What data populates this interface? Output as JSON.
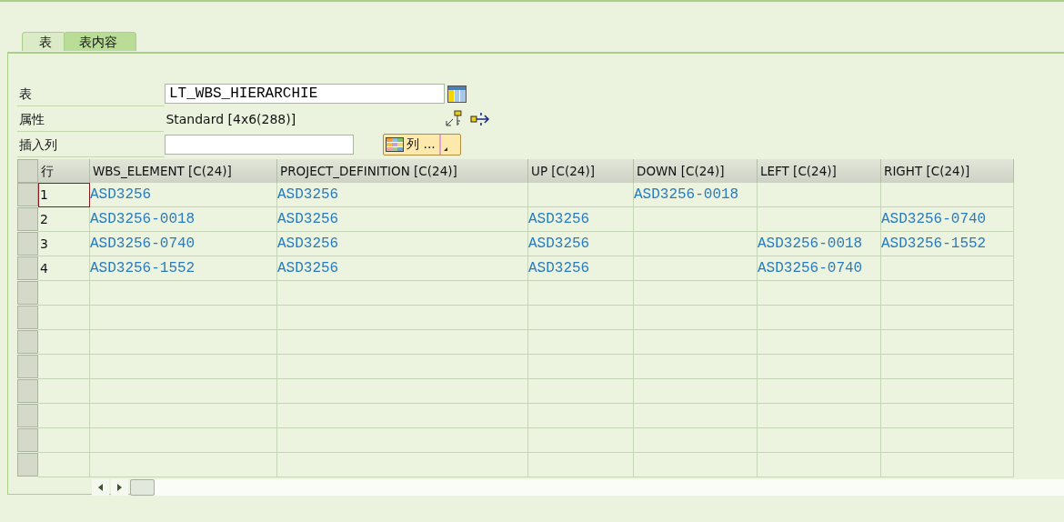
{
  "tabs": [
    {
      "label": "表",
      "selected": false
    },
    {
      "label": "表内容",
      "selected": true
    }
  ],
  "fields": {
    "table_label": "表",
    "table_value": "LT_WBS_HIERARCHIE",
    "attributes_label": "属性",
    "attributes_value": "Standard [4x6(288)]",
    "insert_column_label": "插入列",
    "columns_button": "列 ..."
  },
  "table": {
    "row_number_header": "行",
    "columns": [
      "WBS_ELEMENT [C(24)]",
      "PROJECT_DEFINITION [C(24)]",
      "UP [C(24)]",
      "DOWN [C(24)]",
      "LEFT [C(24)]",
      "RIGHT [C(24)]"
    ],
    "rows": [
      {
        "number": "1",
        "focused": true,
        "cells": [
          "ASD3256",
          "ASD3256",
          "",
          "ASD3256-0018",
          "",
          ""
        ]
      },
      {
        "number": "2",
        "focused": false,
        "cells": [
          "ASD3256-0018",
          "ASD3256",
          "ASD3256",
          "",
          "",
          "ASD3256-0740"
        ]
      },
      {
        "number": "3",
        "focused": false,
        "cells": [
          "ASD3256-0740",
          "ASD3256",
          "ASD3256",
          "",
          "ASD3256-0018",
          "ASD3256-1552"
        ]
      },
      {
        "number": "4",
        "focused": false,
        "cells": [
          "ASD3256-1552",
          "ASD3256",
          "ASD3256",
          "",
          "ASD3256-0740",
          ""
        ]
      }
    ]
  }
}
